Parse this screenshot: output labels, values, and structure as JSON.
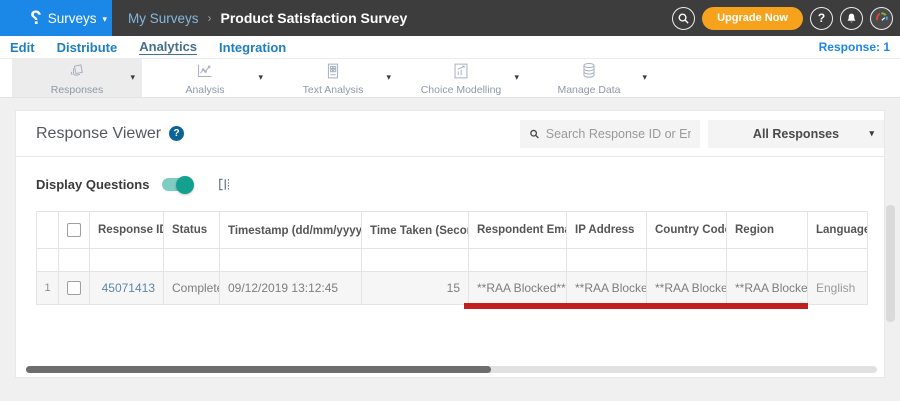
{
  "navbar": {
    "logo_glyph": "?",
    "product_menu_label": "Surveys",
    "breadcrumb": {
      "parent": "My Surveys",
      "separator": "›",
      "current": "Product Satisfaction Survey"
    },
    "upgrade_button": "Upgrade Now",
    "help_glyph": "?"
  },
  "tabs": {
    "items": [
      {
        "label": "Edit"
      },
      {
        "label": "Distribute"
      },
      {
        "label": "Analytics"
      },
      {
        "label": "Integration"
      }
    ],
    "active": "Analytics",
    "response_count": "Response: 1"
  },
  "toolbar": {
    "items": [
      {
        "label": "Responses",
        "icon": "responses-icon",
        "active": true
      },
      {
        "label": "Analysis",
        "icon": "analysis-icon",
        "active": false
      },
      {
        "label": "Text Analysis",
        "icon": "text-analysis-icon",
        "active": false
      },
      {
        "label": "Choice Modelling",
        "icon": "choice-modelling-icon",
        "active": false
      },
      {
        "label": "Manage Data",
        "icon": "database-icon",
        "active": false
      }
    ]
  },
  "viewer": {
    "title": "Response Viewer",
    "help_glyph": "?",
    "search_placeholder": "Search Response ID or Email",
    "responses_filter": "All Responses",
    "display_questions_label": "Display Questions",
    "toggle_state": "on"
  },
  "table": {
    "columns": {
      "response_id": "Response ID",
      "status": "Status",
      "timestamp": "Timestamp (dd/mm/yyyy)",
      "time_taken": "Time Taken (Seconds)",
      "respondent_email": "Respondent Email",
      "ip_address": "IP Address",
      "country_code": "Country Code",
      "region": "Region",
      "language": "Language"
    },
    "row": {
      "index": "1",
      "response_id": "45071413",
      "status": "Completed",
      "timestamp": "09/12/2019 13:12:45",
      "time_taken": "15",
      "respondent_email": "**RAA Blocked**",
      "ip_address": "**RAA Blocked**",
      "country_code": "**RAA Blocked**",
      "region": "**RAA Blocked**",
      "language": "English"
    }
  },
  "icons": {
    "caret_down": "▾",
    "sort_desc": "▼",
    "sort_both": "⇅"
  },
  "colors": {
    "brand_blue": "#1b87e6",
    "navbar_dark": "#3d3d3d",
    "upgrade_orange": "#f6a21c",
    "toggle_teal": "#14a08f",
    "annotation_red": "#c1201f"
  }
}
